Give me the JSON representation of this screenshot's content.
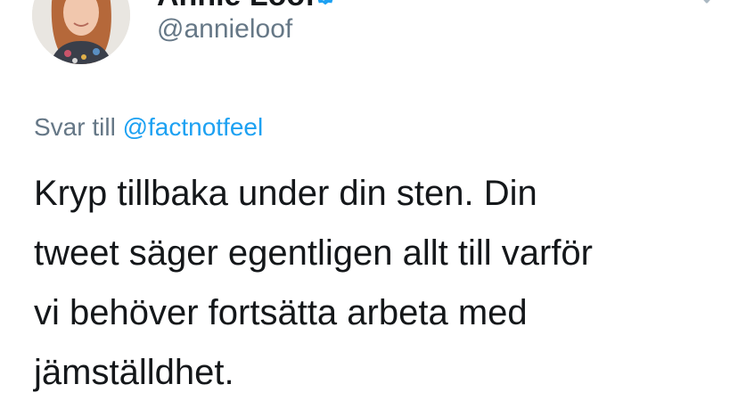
{
  "author": {
    "display_name": "Annie Lööf",
    "handle": "@annieloof",
    "verified": true,
    "avatar_icon": "profile-photo"
  },
  "reply": {
    "prefix": "Svar till",
    "mention": "@factnotfeel"
  },
  "tweet": {
    "lines": [
      "Kryp tillbaka under din sten. Din",
      "tweet säger egentligen allt till varför",
      "vi behöver fortsätta arbeta med",
      "jämställdhet."
    ]
  },
  "colors": {
    "text": "#14171a",
    "secondary": "#657786",
    "link": "#1da1f2"
  }
}
